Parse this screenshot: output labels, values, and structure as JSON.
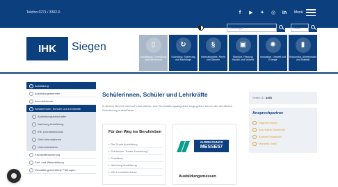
{
  "topbar": {
    "phone": "Telefon 0271 / 3302-0",
    "menu_label": "Menü",
    "social_icons": [
      "facebook-icon",
      "youtube-icon",
      "twitter-icon",
      "instagram-icon",
      "linkedin-icon"
    ]
  },
  "tools": {
    "font_smaller": "a-",
    "font_larger": "a+",
    "search_placeholder": "Suchbegriff",
    "select_value": "Seiten"
  },
  "logo": {
    "mark": "IHK",
    "city": "Siegen"
  },
  "categories": [
    {
      "icon": "book-icon",
      "label": "Ausbildung, Fortbildung und Sachkunde",
      "active": true
    },
    {
      "icon": "refresh-icon",
      "label": "Gründung, Sicherung und Nachfolge",
      "active": false
    },
    {
      "icon": "paragraph-icon",
      "label": "Internationales, Recht und Steuern",
      "active": false
    },
    {
      "icon": "bus-icon",
      "label": "Standort, Planung, Handel und Verkehr",
      "active": false
    },
    {
      "icon": "bulb-icon",
      "label": "Innovation, Umwelt und Energie",
      "active": false
    },
    {
      "icon": "chart-icon",
      "label": "Konjunktur, Arbeitsmarkt und Statistik",
      "active": false
    }
  ],
  "sidenav": [
    {
      "label": "Ausbildung",
      "style": "root"
    },
    {
      "label": "Ausbildungsbetriebe",
      "style": "normal"
    },
    {
      "label": "Auszubildende",
      "style": "normal"
    },
    {
      "label": "Schülerinnen, Schüler und Lehrkräfte",
      "style": "active"
    },
    {
      "label": "Ausbildungsbotschafter",
      "style": "sub"
    },
    {
      "label": "Nachweg Ausbildung",
      "style": "sub"
    },
    {
      "label": "IHK Lehrstellenbörse",
      "style": "sub"
    },
    {
      "label": "Geld Informationen",
      "style": "sub"
    },
    {
      "label": "Unterrichtsideen",
      "style": "sub"
    },
    {
      "label": "Fachkräftesicherung",
      "style": "normal"
    },
    {
      "label": "Fort- und Weiterbildung",
      "style": "normal"
    },
    {
      "label": "Verwaltungsrechtliche Prüfungen",
      "style": "normal"
    }
  ],
  "main": {
    "heading": "Schülerinnen, Schüler und Lehrkräfte",
    "intro": "In diesem Bereich sind auf Informations- und Veranstaltungsangebote eingegeben, die bei der beruflichen Orientierung unterstützen.",
    "way_box": {
      "title": "Für den Weg ins Berufsleben",
      "items": [
        "Die Duale Ausbildung",
        "Entdecken \"Duale Ausbildung\"",
        "Praktikum",
        "Nachweg Ausbildung",
        "IHK Lehrstellenbörse"
      ]
    },
    "mess_box": {
      "banner_top": "AUSBILDUNGS",
      "banner_big": "MESSE57",
      "title": "Ausbildungsmessen"
    }
  },
  "right": {
    "doc_label": "Seiten-ID:",
    "doc_id": "4498",
    "contacts_title": "Ansprechpartner",
    "contacts": [
      "Dagmar Kleine",
      "Ann-Katrin Steinhofel",
      "Andrea Pangsioch",
      "Manuela Stahl"
    ]
  }
}
